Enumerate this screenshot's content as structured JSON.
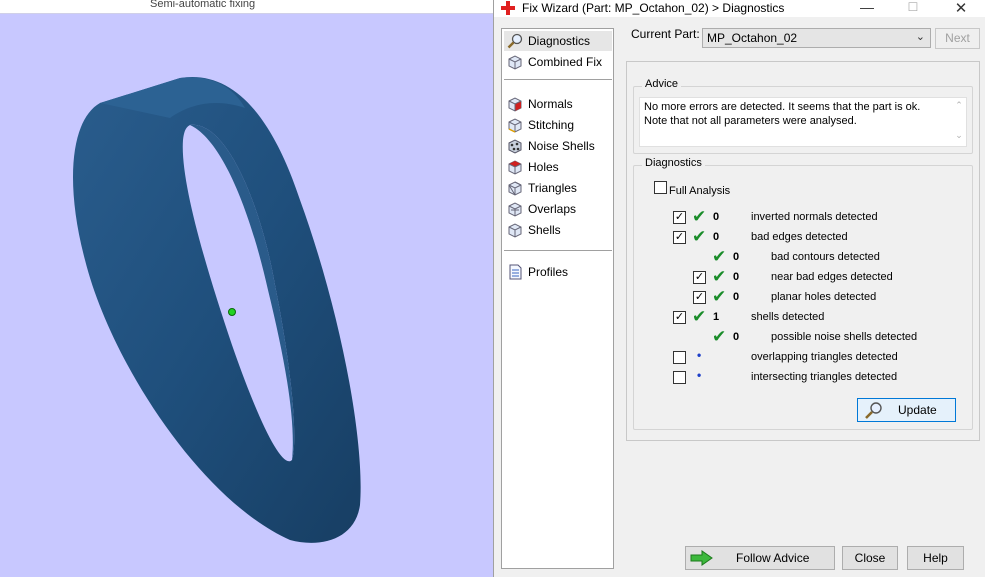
{
  "viewport": {
    "title": "Semi-automatic fixing"
  },
  "window": {
    "title": "Fix Wizard (Part: MP_Octahon_02) > Diagnostics",
    "minimize": "—",
    "maximize": "☐",
    "close": "✕"
  },
  "sidebar": {
    "items": [
      {
        "label": "Diagnostics",
        "icon": "magnifier-icon"
      },
      {
        "label": "Combined Fix",
        "icon": "cube-icon"
      },
      {
        "label": "Normals",
        "icon": "normals-cube-icon"
      },
      {
        "label": "Stitching",
        "icon": "stitching-cube-icon"
      },
      {
        "label": "Noise Shells",
        "icon": "noise-shells-icon"
      },
      {
        "label": "Holes",
        "icon": "holes-cube-icon"
      },
      {
        "label": "Triangles",
        "icon": "triangles-cube-icon"
      },
      {
        "label": "Overlaps",
        "icon": "overlaps-cube-icon"
      },
      {
        "label": "Shells",
        "icon": "shells-cube-icon"
      },
      {
        "label": "Profiles",
        "icon": "document-icon"
      }
    ]
  },
  "current_part": {
    "label": "Current Part:",
    "value": "MP_Octahon_02",
    "next_label": "Next"
  },
  "advice": {
    "title": "Advice",
    "text_line1": "No more errors are detected. It seems that the part is ok.",
    "text_line2": "Note that not all parameters were analysed."
  },
  "diagnostics": {
    "title": "Diagnostics",
    "full_analysis_label": "Full Analysis",
    "full_analysis_checked": false,
    "rows": [
      {
        "checked": true,
        "status": "ok",
        "count": "0",
        "label": "inverted normals detected"
      },
      {
        "checked": true,
        "status": "ok",
        "count": "0",
        "label": "bad edges detected"
      },
      {
        "checked": null,
        "status": "ok",
        "count": "0",
        "label": "bad contours detected"
      },
      {
        "checked": true,
        "status": "ok",
        "count": "0",
        "label": "near bad edges detected"
      },
      {
        "checked": true,
        "status": "ok",
        "count": "0",
        "label": "planar holes detected"
      },
      {
        "checked": true,
        "status": "ok",
        "count": "1",
        "label": "shells detected"
      },
      {
        "checked": null,
        "status": "ok",
        "count": "0",
        "label": "possible noise shells detected"
      },
      {
        "checked": false,
        "status": "pending",
        "count": "",
        "label": "overlapping triangles detected"
      },
      {
        "checked": false,
        "status": "pending",
        "count": "",
        "label": "intersecting triangles detected"
      }
    ],
    "update_label": "Update"
  },
  "buttons": {
    "follow_advice": "Follow Advice",
    "close": "Close",
    "help": "Help"
  },
  "colors": {
    "ring": "#1f4f7c",
    "background": "#c8c8ff",
    "check": "#1a8c2a",
    "accent": "#0078d7"
  }
}
